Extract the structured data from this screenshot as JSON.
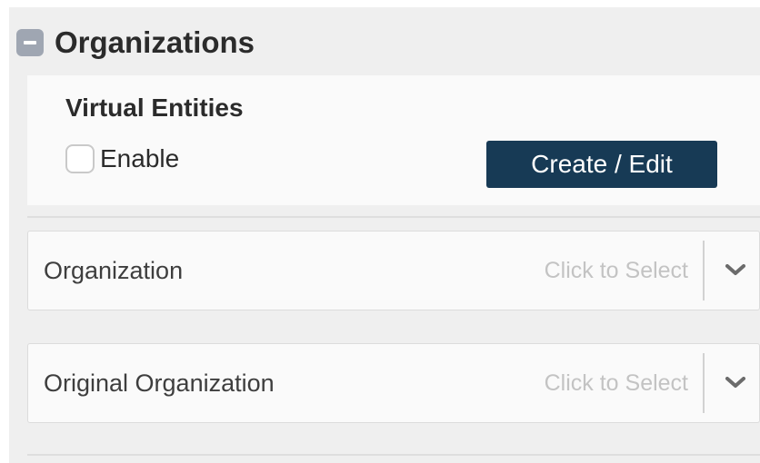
{
  "section": {
    "title": "Organizations",
    "collapse_icon": "minus-square-icon"
  },
  "virtual_entities": {
    "title": "Virtual Entities",
    "enable_label": "Enable",
    "enable_checked": false,
    "create_edit_label": "Create / Edit"
  },
  "fields": [
    {
      "label": "Organization",
      "placeholder": "Click to Select",
      "icon": "chevron-down-icon"
    },
    {
      "label": "Original Organization",
      "placeholder": "Click to Select",
      "icon": "chevron-down-icon"
    }
  ],
  "colors": {
    "button_bg": "#173a55",
    "collapse_icon_bg": "#9fa6b2",
    "panel_bg": "#efefef"
  }
}
